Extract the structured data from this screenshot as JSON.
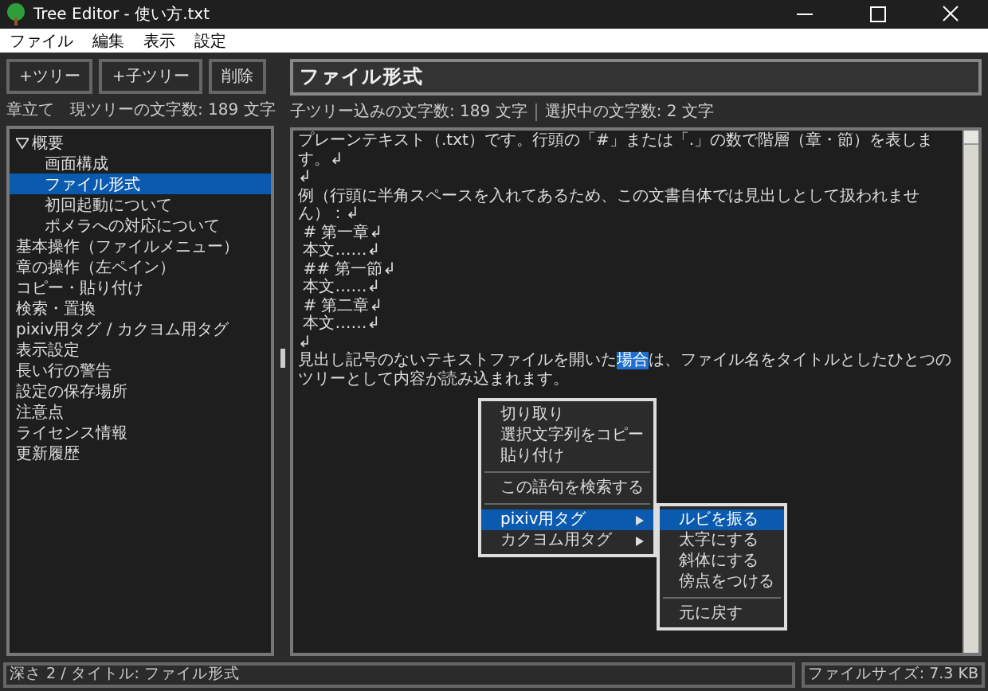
{
  "window": {
    "title": "Tree Editor - 使い方.txt"
  },
  "menu": [
    "ファイル",
    "編集",
    "表示",
    "設定"
  ],
  "buttons": [
    "+ツリー",
    "+子ツリー",
    "削除"
  ],
  "left_status": {
    "label": "章立て",
    "count": "現ツリーの文字数: 189 文字"
  },
  "tree": [
    {
      "label": "概要",
      "expanded": true,
      "selected": false,
      "children": [
        {
          "label": "画面構成",
          "selected": false
        },
        {
          "label": "ファイル形式",
          "selected": true
        },
        {
          "label": "初回起動について",
          "selected": false
        },
        {
          "label": "ポメラへの対応について",
          "selected": false
        }
      ]
    },
    {
      "label": "基本操作（ファイルメニュー）",
      "selected": false
    },
    {
      "label": "章の操作（左ペイン）",
      "selected": false
    },
    {
      "label": "コピー・貼り付け",
      "selected": false
    },
    {
      "label": "検索・置換",
      "selected": false
    },
    {
      "label": "pixiv用タグ / カクヨム用タグ",
      "selected": false
    },
    {
      "label": "表示設定",
      "selected": false
    },
    {
      "label": "長い行の警告",
      "selected": false
    },
    {
      "label": "設定の保存場所",
      "selected": false
    },
    {
      "label": "注意点",
      "selected": false
    },
    {
      "label": "ライセンス情報",
      "selected": false
    },
    {
      "label": "更新履歴",
      "selected": false
    }
  ],
  "title_field": {
    "value": "ファイル形式"
  },
  "counters": [
    "子ツリー込みの文字数: 189 文字",
    "選択中の文字数: 2 文字"
  ],
  "editor": {
    "lines": [
      {
        "text": "プレーンテキスト（.txt）です。行頭の「#」または「.」の数で階層（章・節）を表します。↲"
      },
      {
        "text": "↲"
      },
      {
        "text": "例（行頭に半角スペースを入れてあるため、この文書自体では見出しとして扱われません）：↲"
      },
      {
        "text": " # 第一章↲"
      },
      {
        "text": " 本文……↲"
      },
      {
        "text": " ## 第一節↲"
      },
      {
        "text": " 本文……↲"
      },
      {
        "text": " # 第二章↲"
      },
      {
        "text": " 本文……↲"
      },
      {
        "text": "↲"
      },
      {
        "text": "見出し記号のないテキストファイルを開いた",
        "selection": "場合",
        "after": "は、ファイル名をタイトルとしたひとつのツリーとして内容が読み込まれます。"
      }
    ]
  },
  "context_menu": [
    {
      "kind": "item",
      "label": "切り取り",
      "selected": false
    },
    {
      "kind": "item",
      "label": "選択文字列をコピー",
      "selected": false
    },
    {
      "kind": "item",
      "label": "貼り付け",
      "selected": false
    },
    {
      "kind": "separator"
    },
    {
      "kind": "item",
      "label": "この語句を検索する",
      "selected": false
    },
    {
      "kind": "separator"
    },
    {
      "kind": "submenu",
      "label": "pixiv用タグ",
      "selected": true,
      "children": [
        {
          "kind": "item",
          "label": "ルビを振る",
          "selected": true
        },
        {
          "kind": "item",
          "label": "太字にする",
          "selected": false
        },
        {
          "kind": "item",
          "label": "斜体にする",
          "selected": false
        },
        {
          "kind": "item",
          "label": "傍点をつける",
          "selected": false
        },
        {
          "kind": "separator"
        },
        {
          "kind": "item",
          "label": "元に戻す",
          "selected": false
        }
      ]
    },
    {
      "kind": "submenu",
      "label": "カクヨム用タグ",
      "selected": false
    }
  ],
  "status_bar": {
    "path": "深さ 2 / タイトル: ファイル形式",
    "file_size": "ファイルサイズ: 7.3 KB"
  }
}
